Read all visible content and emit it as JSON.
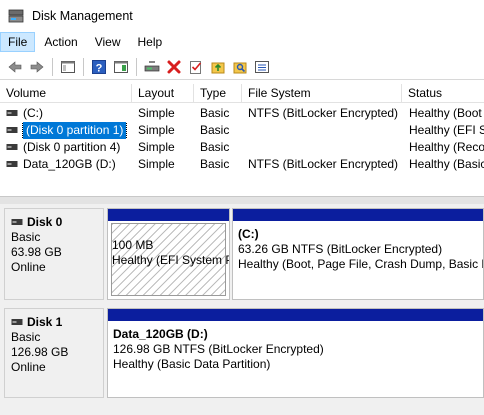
{
  "window": {
    "title": "Disk Management"
  },
  "menu": [
    {
      "label": "File",
      "active": true
    },
    {
      "label": "Action",
      "active": false
    },
    {
      "label": "View",
      "active": false
    },
    {
      "label": "Help",
      "active": false
    }
  ],
  "volume_list": {
    "columns": [
      "Volume",
      "Layout",
      "Type",
      "File System",
      "Status"
    ],
    "rows": [
      {
        "volume": "(C:)",
        "layout": "Simple",
        "type": "Basic",
        "fs": "NTFS (BitLocker Encrypted)",
        "status": "Healthy (Boot",
        "selected": false
      },
      {
        "volume": "(Disk 0 partition 1)",
        "layout": "Simple",
        "type": "Basic",
        "fs": "",
        "status": "Healthy (EFI Sy",
        "selected": true
      },
      {
        "volume": "(Disk 0 partition 4)",
        "layout": "Simple",
        "type": "Basic",
        "fs": "",
        "status": "Healthy (Reco",
        "selected": false
      },
      {
        "volume": "Data_120GB (D:)",
        "layout": "Simple",
        "type": "Basic",
        "fs": "NTFS (BitLocker Encrypted)",
        "status": "Healthy (Basic",
        "selected": false
      }
    ]
  },
  "disks": [
    {
      "name": "Disk 0",
      "type": "Basic",
      "size": "63.98 GB",
      "state": "Online",
      "partitions": [
        {
          "name": "",
          "line1": "100 MB",
          "line2": "Healthy (EFI System P",
          "hatched": true
        },
        {
          "name": "(C:)",
          "line1": "63.26 GB NTFS (BitLocker Encrypted)",
          "line2": "Healthy (Boot, Page File, Crash Dump, Basic D",
          "hatched": false
        }
      ]
    },
    {
      "name": "Disk 1",
      "type": "Basic",
      "size": "126.98 GB",
      "state": "Online",
      "partitions": [
        {
          "name": "Data_120GB  (D:)",
          "line1": "126.98 GB NTFS (BitLocker Encrypted)",
          "line2": "Healthy (Basic Data Partition)",
          "hatched": false
        }
      ]
    }
  ],
  "colors": {
    "partition_stripe": "#0b1e9e",
    "selection": "#0078d7",
    "menu_active": "#cce8ff"
  }
}
